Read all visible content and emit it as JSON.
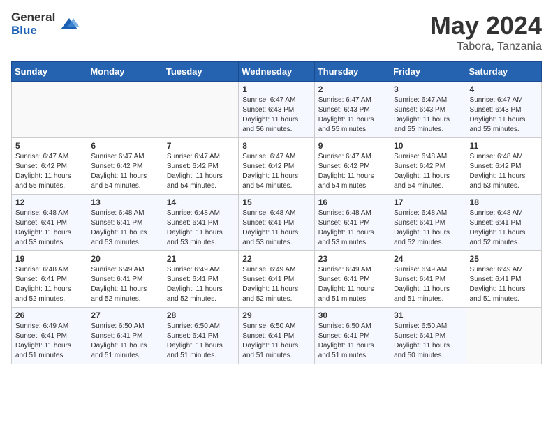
{
  "logo": {
    "general": "General",
    "blue": "Blue"
  },
  "title": "May 2024",
  "subtitle": "Tabora, Tanzania",
  "days_of_week": [
    "Sunday",
    "Monday",
    "Tuesday",
    "Wednesday",
    "Thursday",
    "Friday",
    "Saturday"
  ],
  "weeks": [
    [
      {
        "day": "",
        "info": ""
      },
      {
        "day": "",
        "info": ""
      },
      {
        "day": "",
        "info": ""
      },
      {
        "day": "1",
        "info": "Sunrise: 6:47 AM\nSunset: 6:43 PM\nDaylight: 11 hours\nand 56 minutes."
      },
      {
        "day": "2",
        "info": "Sunrise: 6:47 AM\nSunset: 6:43 PM\nDaylight: 11 hours\nand 55 minutes."
      },
      {
        "day": "3",
        "info": "Sunrise: 6:47 AM\nSunset: 6:43 PM\nDaylight: 11 hours\nand 55 minutes."
      },
      {
        "day": "4",
        "info": "Sunrise: 6:47 AM\nSunset: 6:43 PM\nDaylight: 11 hours\nand 55 minutes."
      }
    ],
    [
      {
        "day": "5",
        "info": "Sunrise: 6:47 AM\nSunset: 6:42 PM\nDaylight: 11 hours\nand 55 minutes."
      },
      {
        "day": "6",
        "info": "Sunrise: 6:47 AM\nSunset: 6:42 PM\nDaylight: 11 hours\nand 54 minutes."
      },
      {
        "day": "7",
        "info": "Sunrise: 6:47 AM\nSunset: 6:42 PM\nDaylight: 11 hours\nand 54 minutes."
      },
      {
        "day": "8",
        "info": "Sunrise: 6:47 AM\nSunset: 6:42 PM\nDaylight: 11 hours\nand 54 minutes."
      },
      {
        "day": "9",
        "info": "Sunrise: 6:47 AM\nSunset: 6:42 PM\nDaylight: 11 hours\nand 54 minutes."
      },
      {
        "day": "10",
        "info": "Sunrise: 6:48 AM\nSunset: 6:42 PM\nDaylight: 11 hours\nand 54 minutes."
      },
      {
        "day": "11",
        "info": "Sunrise: 6:48 AM\nSunset: 6:42 PM\nDaylight: 11 hours\nand 53 minutes."
      }
    ],
    [
      {
        "day": "12",
        "info": "Sunrise: 6:48 AM\nSunset: 6:41 PM\nDaylight: 11 hours\nand 53 minutes."
      },
      {
        "day": "13",
        "info": "Sunrise: 6:48 AM\nSunset: 6:41 PM\nDaylight: 11 hours\nand 53 minutes."
      },
      {
        "day": "14",
        "info": "Sunrise: 6:48 AM\nSunset: 6:41 PM\nDaylight: 11 hours\nand 53 minutes."
      },
      {
        "day": "15",
        "info": "Sunrise: 6:48 AM\nSunset: 6:41 PM\nDaylight: 11 hours\nand 53 minutes."
      },
      {
        "day": "16",
        "info": "Sunrise: 6:48 AM\nSunset: 6:41 PM\nDaylight: 11 hours\nand 53 minutes."
      },
      {
        "day": "17",
        "info": "Sunrise: 6:48 AM\nSunset: 6:41 PM\nDaylight: 11 hours\nand 52 minutes."
      },
      {
        "day": "18",
        "info": "Sunrise: 6:48 AM\nSunset: 6:41 PM\nDaylight: 11 hours\nand 52 minutes."
      }
    ],
    [
      {
        "day": "19",
        "info": "Sunrise: 6:48 AM\nSunset: 6:41 PM\nDaylight: 11 hours\nand 52 minutes."
      },
      {
        "day": "20",
        "info": "Sunrise: 6:49 AM\nSunset: 6:41 PM\nDaylight: 11 hours\nand 52 minutes."
      },
      {
        "day": "21",
        "info": "Sunrise: 6:49 AM\nSunset: 6:41 PM\nDaylight: 11 hours\nand 52 minutes."
      },
      {
        "day": "22",
        "info": "Sunrise: 6:49 AM\nSunset: 6:41 PM\nDaylight: 11 hours\nand 52 minutes."
      },
      {
        "day": "23",
        "info": "Sunrise: 6:49 AM\nSunset: 6:41 PM\nDaylight: 11 hours\nand 51 minutes."
      },
      {
        "day": "24",
        "info": "Sunrise: 6:49 AM\nSunset: 6:41 PM\nDaylight: 11 hours\nand 51 minutes."
      },
      {
        "day": "25",
        "info": "Sunrise: 6:49 AM\nSunset: 6:41 PM\nDaylight: 11 hours\nand 51 minutes."
      }
    ],
    [
      {
        "day": "26",
        "info": "Sunrise: 6:49 AM\nSunset: 6:41 PM\nDaylight: 11 hours\nand 51 minutes."
      },
      {
        "day": "27",
        "info": "Sunrise: 6:50 AM\nSunset: 6:41 PM\nDaylight: 11 hours\nand 51 minutes."
      },
      {
        "day": "28",
        "info": "Sunrise: 6:50 AM\nSunset: 6:41 PM\nDaylight: 11 hours\nand 51 minutes."
      },
      {
        "day": "29",
        "info": "Sunrise: 6:50 AM\nSunset: 6:41 PM\nDaylight: 11 hours\nand 51 minutes."
      },
      {
        "day": "30",
        "info": "Sunrise: 6:50 AM\nSunset: 6:41 PM\nDaylight: 11 hours\nand 51 minutes."
      },
      {
        "day": "31",
        "info": "Sunrise: 6:50 AM\nSunset: 6:41 PM\nDaylight: 11 hours\nand 50 minutes."
      },
      {
        "day": "",
        "info": ""
      }
    ]
  ]
}
